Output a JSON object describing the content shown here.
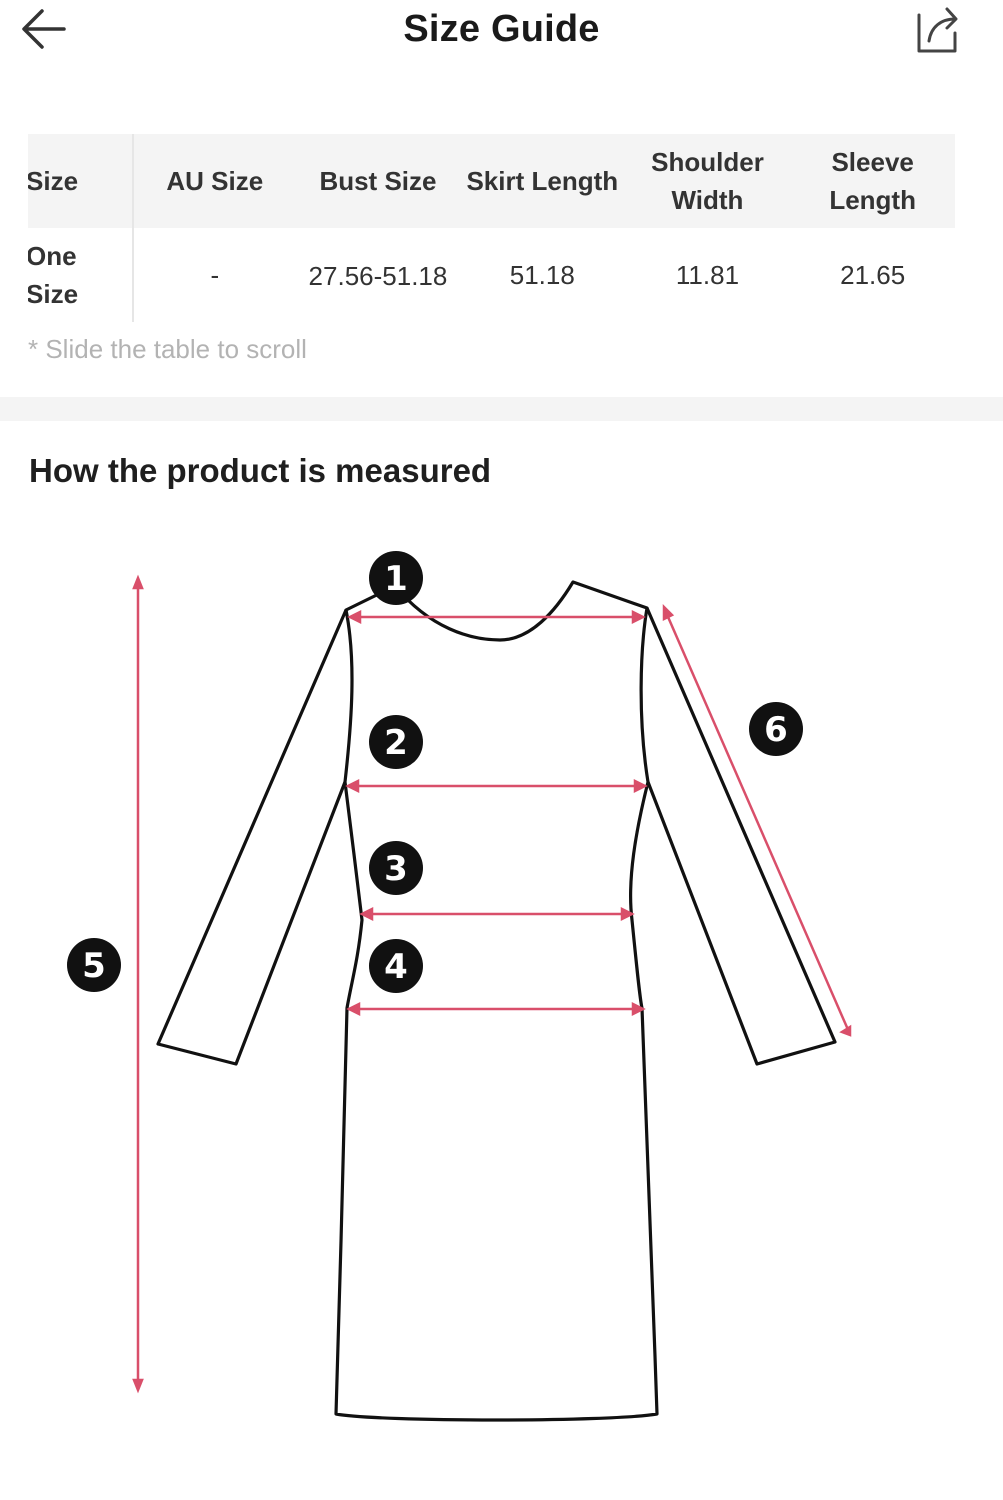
{
  "header": {
    "title": "Size Guide",
    "back_icon": "arrow-left-icon",
    "share_icon": "share-icon"
  },
  "size_table": {
    "columns": [
      "Size",
      "AU Size",
      "Bust Size",
      "Skirt Length",
      "Shoulder Width",
      "Sleeve Length"
    ],
    "rows": [
      {
        "size": "One Size",
        "au_size": "-",
        "bust_size": "27.56-51.18",
        "skirt_length": "51.18",
        "shoulder_width": "11.81",
        "sleeve_length": "21.65"
      }
    ]
  },
  "hint": "* Slide the table to scroll",
  "measure_section": {
    "title": "How the product is measured",
    "markers": [
      "1",
      "2",
      "3",
      "4",
      "5",
      "6"
    ]
  },
  "colors": {
    "measure_line": "#d94f6a",
    "header_bg": "#f4f4f4",
    "hint_text": "#b3b3b3"
  }
}
